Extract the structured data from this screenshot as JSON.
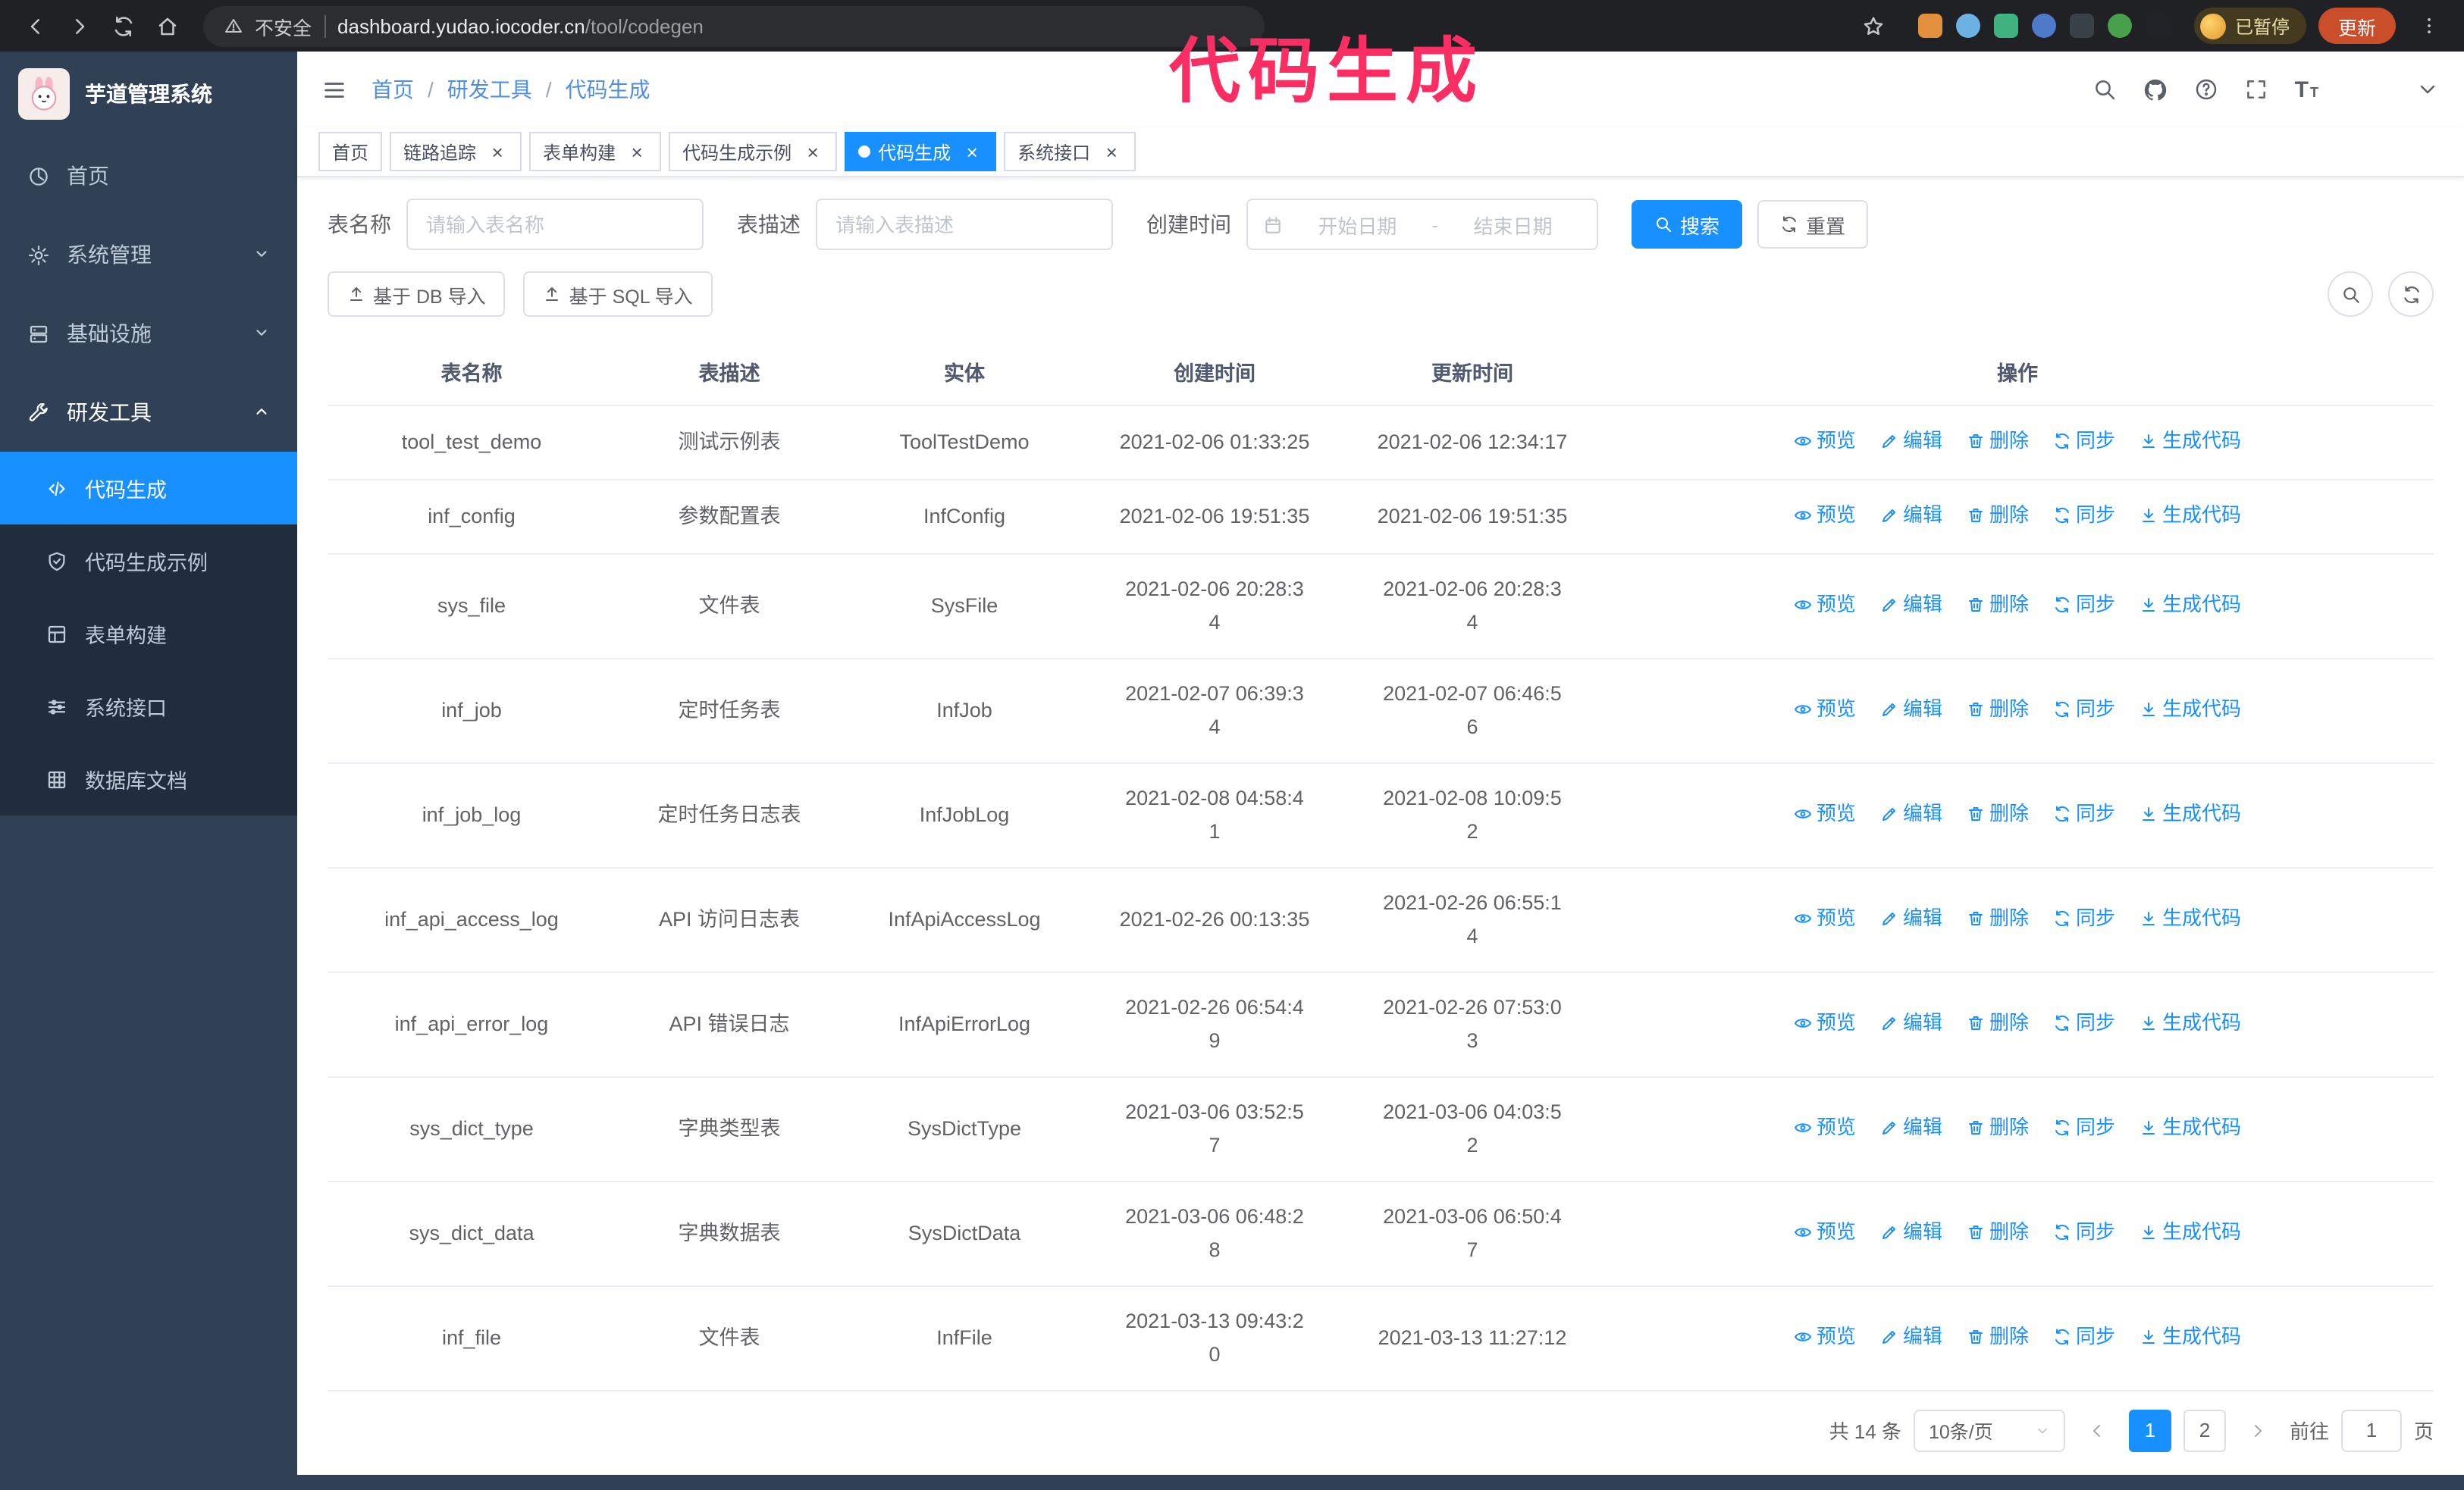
{
  "browser": {
    "security_label": "不安全",
    "url_host": "dashboard.yudao.iocoder.cn",
    "url_path": "/tool/codegen",
    "profile_chip_label": "已暂停",
    "update_label": "更新",
    "extension_colors": [
      "#e2903d",
      "#6cb3e4",
      "#3fb27f",
      "#4f79c9",
      "#394149",
      "#47a04b",
      "#1f2328"
    ]
  },
  "annotation": {
    "text": "代码生成",
    "color": "#fa2e62"
  },
  "sidebar": {
    "logo_title": "芋道管理系统",
    "menu": [
      {
        "label": "首页",
        "icon": "dashboard"
      },
      {
        "label": "系统管理",
        "icon": "gear",
        "chevron": "down"
      },
      {
        "label": "基础设施",
        "icon": "infra",
        "chevron": "down"
      },
      {
        "label": "研发工具",
        "icon": "tool",
        "chevron": "up",
        "expanded": true,
        "children": [
          {
            "label": "代码生成",
            "icon": "code",
            "active": true
          },
          {
            "label": "代码生成示例",
            "icon": "shield"
          },
          {
            "label": "表单构建",
            "icon": "form"
          },
          {
            "label": "系统接口",
            "icon": "sliders"
          },
          {
            "label": "数据库文档",
            "icon": "grid"
          }
        ]
      }
    ]
  },
  "header": {
    "breadcrumb": [
      "首页",
      "研发工具",
      "代码生成"
    ],
    "separator": "/"
  },
  "tabs": [
    {
      "label": "首页",
      "closable": false,
      "active": false
    },
    {
      "label": "链路追踪",
      "closable": true,
      "active": false
    },
    {
      "label": "表单构建",
      "closable": true,
      "active": false
    },
    {
      "label": "代码生成示例",
      "closable": true,
      "active": false
    },
    {
      "label": "代码生成",
      "closable": true,
      "active": true
    },
    {
      "label": "系统接口",
      "closable": true,
      "active": false
    }
  ],
  "filters": {
    "name_label": "表名称",
    "name_placeholder": "请输入表名称",
    "desc_label": "表描述",
    "desc_placeholder": "请输入表描述",
    "time_label": "创建时间",
    "start_placeholder": "开始日期",
    "range_separator": "-",
    "end_placeholder": "结束日期",
    "search_label": "搜索",
    "reset_label": "重置"
  },
  "toolbar": {
    "import_db_label": "基于 DB 导入",
    "import_sql_label": "基于 SQL 导入"
  },
  "table": {
    "columns": [
      "表名称",
      "表描述",
      "实体",
      "创建时间",
      "更新时间",
      "操作"
    ],
    "actions": [
      {
        "label": "预览",
        "icon": "eye"
      },
      {
        "label": "编辑",
        "icon": "edit"
      },
      {
        "label": "删除",
        "icon": "trash"
      },
      {
        "label": "同步",
        "icon": "sync"
      },
      {
        "label": "生成代码",
        "icon": "download"
      }
    ],
    "rows": [
      {
        "name": "tool_test_demo",
        "desc": "测试示例表",
        "entity": "ToolTestDemo",
        "created": "2021-02-06 01:33:25",
        "updated": "2021-02-06 12:34:17"
      },
      {
        "name": "inf_config",
        "desc": "参数配置表",
        "entity": "InfConfig",
        "created": "2021-02-06 19:51:35",
        "updated": "2021-02-06 19:51:35"
      },
      {
        "name": "sys_file",
        "desc": "文件表",
        "entity": "SysFile",
        "created": "2021-02-06 20:28:3\n4",
        "updated": "2021-02-06 20:28:3\n4"
      },
      {
        "name": "inf_job",
        "desc": "定时任务表",
        "entity": "InfJob",
        "created": "2021-02-07 06:39:3\n4",
        "updated": "2021-02-07 06:46:5\n6"
      },
      {
        "name": "inf_job_log",
        "desc": "定时任务日志表",
        "entity": "InfJobLog",
        "created": "2021-02-08 04:58:4\n1",
        "updated": "2021-02-08 10:09:5\n2"
      },
      {
        "name": "inf_api_access_log",
        "desc": "API 访问日志表",
        "entity": "InfApiAccessLog",
        "created": "2021-02-26 00:13:35",
        "updated": "2021-02-26 06:55:1\n4"
      },
      {
        "name": "inf_api_error_log",
        "desc": "API 错误日志",
        "entity": "InfApiErrorLog",
        "created": "2021-02-26 06:54:4\n9",
        "updated": "2021-02-26 07:53:0\n3"
      },
      {
        "name": "sys_dict_type",
        "desc": "字典类型表",
        "entity": "SysDictType",
        "created": "2021-03-06 03:52:5\n7",
        "updated": "2021-03-06 04:03:5\n2"
      },
      {
        "name": "sys_dict_data",
        "desc": "字典数据表",
        "entity": "SysDictData",
        "created": "2021-03-06 06:48:2\n8",
        "updated": "2021-03-06 06:50:4\n7"
      },
      {
        "name": "inf_file",
        "desc": "文件表",
        "entity": "InfFile",
        "created": "2021-03-13 09:43:2\n0",
        "updated": "2021-03-13 11:27:12"
      }
    ]
  },
  "pagination": {
    "total_label": "共 14 条",
    "page_size_label": "10条/页",
    "pages": [
      "1",
      "2"
    ],
    "current": "1",
    "goto_label": "前往",
    "goto_value": "1",
    "goto_suffix": "页"
  },
  "colors": {
    "primary": "#1890ff",
    "sidebar_bg": "#304156",
    "submenu_bg": "#1f2d3d"
  }
}
